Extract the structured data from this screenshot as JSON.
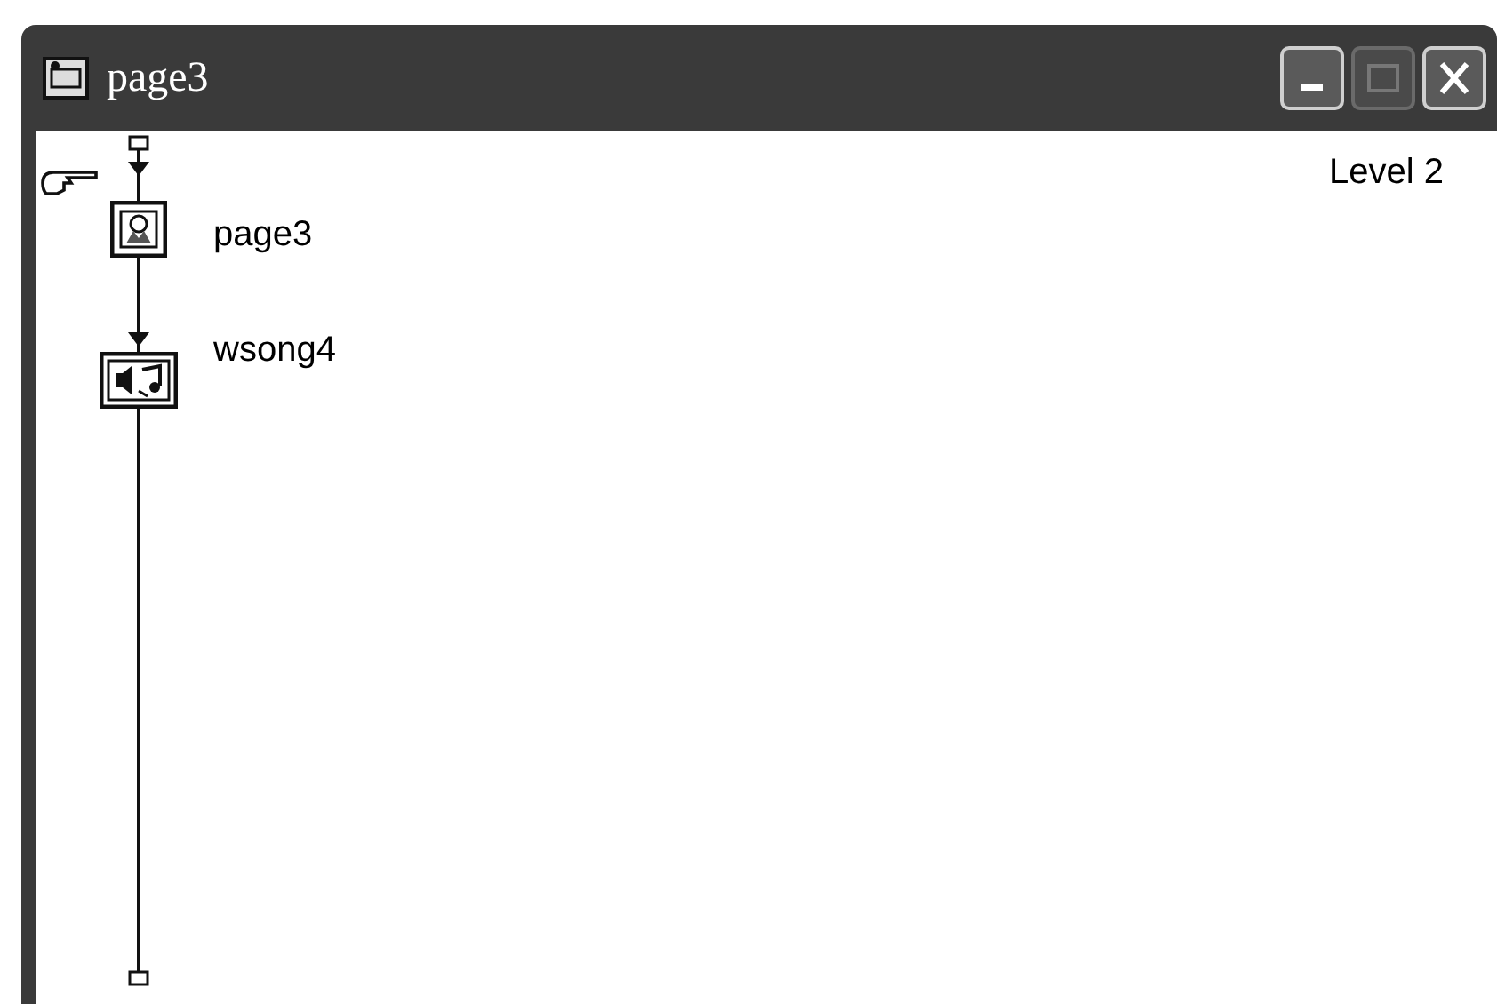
{
  "window": {
    "title": "page3",
    "buttons": [
      {
        "kind": "minimize",
        "disabled": false
      },
      {
        "kind": "maximize",
        "disabled": true
      },
      {
        "kind": "close",
        "disabled": false
      }
    ]
  },
  "level_label": "Level 2",
  "flowline": {
    "icons": [
      {
        "kind": "display",
        "label": "page3"
      },
      {
        "kind": "sound",
        "label": "wsong4"
      }
    ]
  }
}
